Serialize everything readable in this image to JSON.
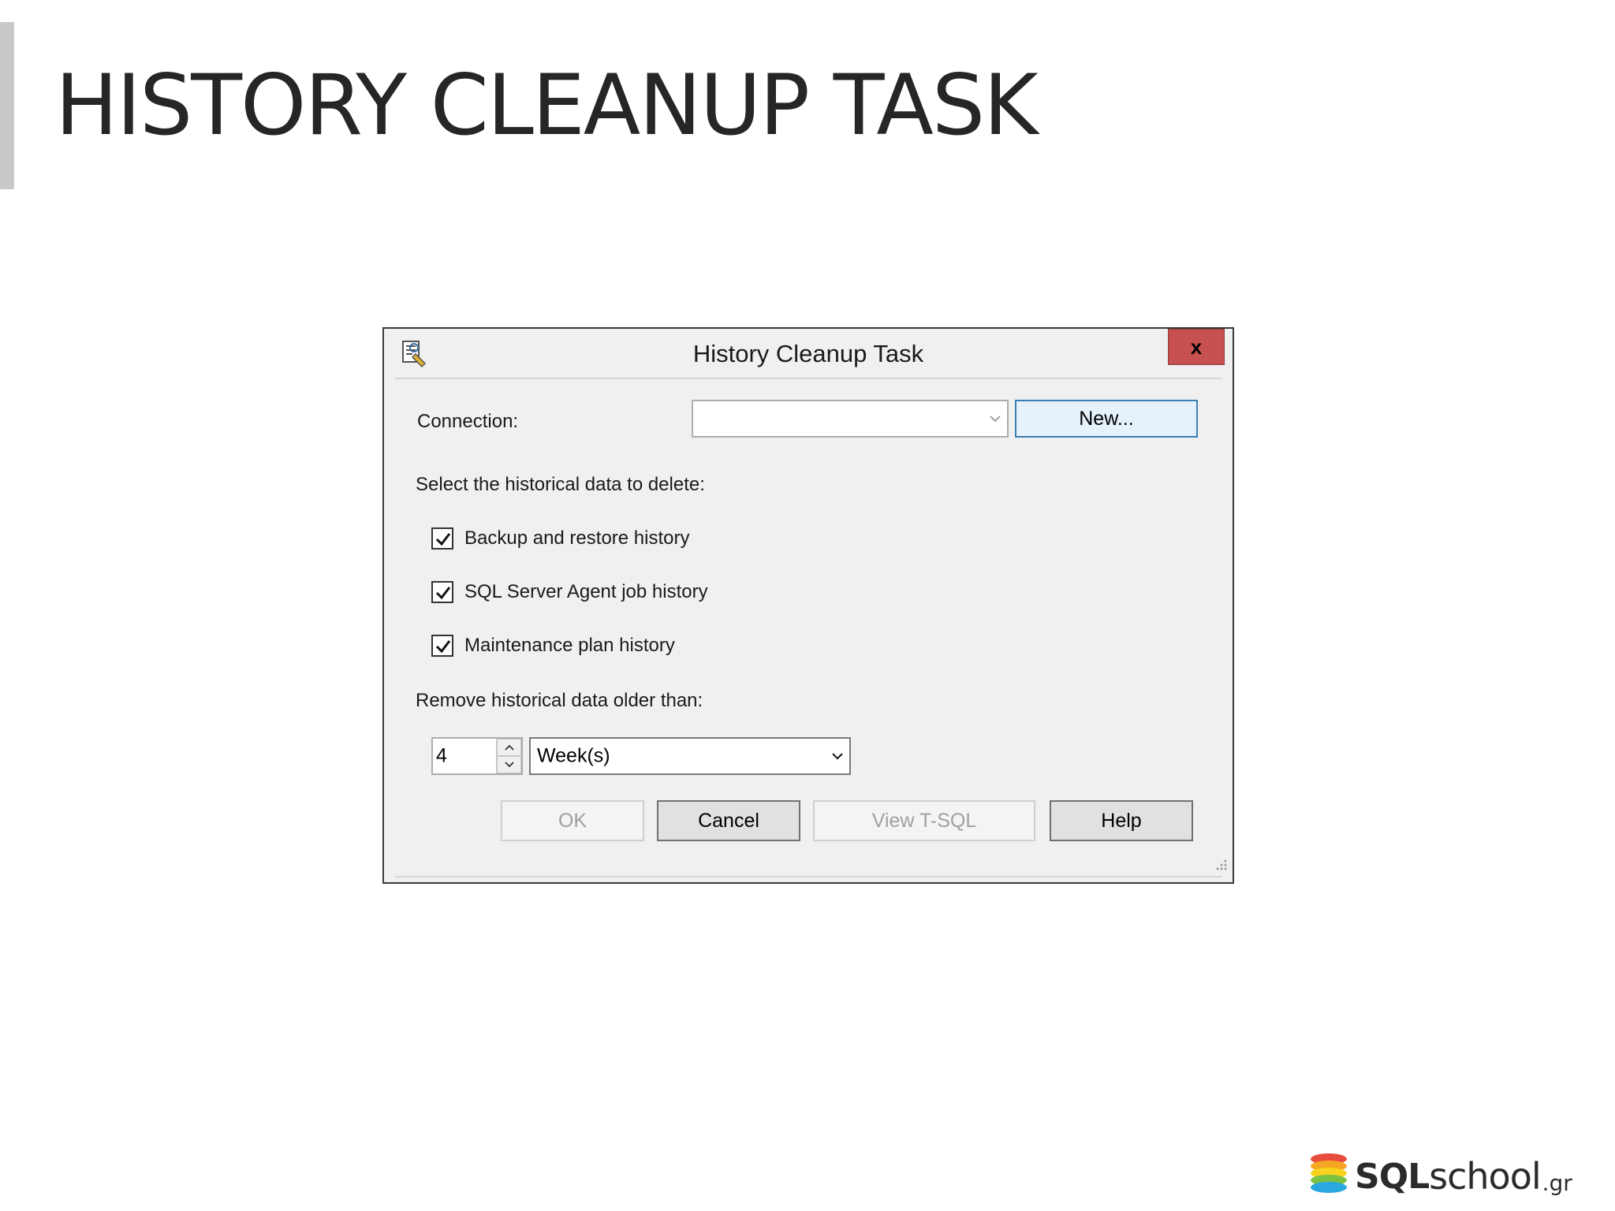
{
  "slide": {
    "title": "HISTORY CLEANUP TASK"
  },
  "dialog": {
    "title": "History Cleanup Task",
    "close_label": "x",
    "connection": {
      "label": "Connection:",
      "value": "",
      "new_button": "New..."
    },
    "select_label": "Select the historical data to delete:",
    "options": [
      {
        "label": "Backup and restore history",
        "checked": true
      },
      {
        "label": "SQL Server Agent job history",
        "checked": true
      },
      {
        "label": "Maintenance plan history",
        "checked": true
      }
    ],
    "remove_label": "Remove historical data older than:",
    "age": {
      "value": "4",
      "unit": "Week(s)"
    },
    "buttons": {
      "ok": "OK",
      "cancel": "Cancel",
      "view_tsql": "View T-SQL",
      "help": "Help"
    }
  },
  "logo": {
    "part1": "SQL",
    "part2": "school",
    "part3": ".gr",
    "colors": [
      "#e84c3d",
      "#f5a623",
      "#f8d21c",
      "#7cc242",
      "#2aa7df"
    ]
  }
}
